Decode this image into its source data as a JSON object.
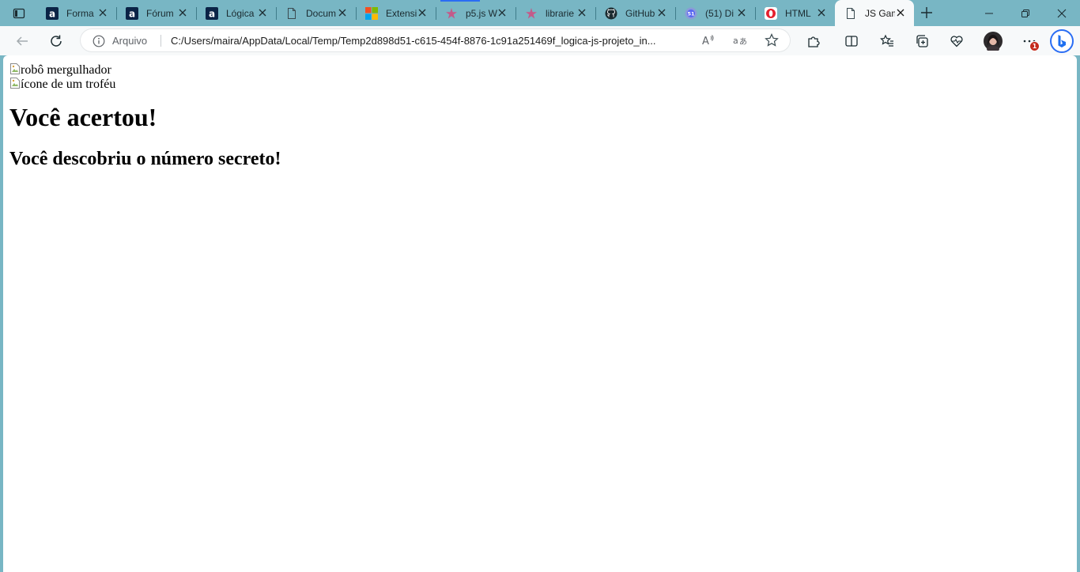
{
  "browser": {
    "tabs": [
      {
        "title": "Forma",
        "icon": "alura-icon"
      },
      {
        "title": "Fórum",
        "icon": "alura-icon"
      },
      {
        "title": "Lógica",
        "icon": "alura-icon"
      },
      {
        "title": "Docum",
        "icon": "document-icon"
      },
      {
        "title": "Extensi",
        "icon": "microsoft-icon"
      },
      {
        "title": "p5.js W",
        "icon": "p5-star-icon"
      },
      {
        "title": "librarie",
        "icon": "p5-star-icon"
      },
      {
        "title": "GitHub",
        "icon": "github-icon"
      },
      {
        "title": "(51) Di",
        "icon": "discord-icon"
      },
      {
        "title": "HTML",
        "icon": "opera-icon"
      },
      {
        "title": "JS Gam",
        "icon": "document-icon",
        "active": true
      }
    ],
    "address": {
      "scheme_label": "Arquivo",
      "url": "C:/Users/maira/AppData/Local/Temp/Temp2d898d51-c615-454f-8876-1c91a251469f_logica-js-projeto_in..."
    },
    "notification_count": "1",
    "colors": {
      "tabstrip": "#78b6c4",
      "toolbar": "#f7f9fa",
      "accent": "#2a6df4",
      "badge": "#c42b1c"
    }
  },
  "page": {
    "images": [
      {
        "alt": "robô mergulhador"
      },
      {
        "alt": "ícone de um troféu"
      }
    ],
    "title": "Você acertou!",
    "subtitle": "Você descobriu o número secreto!"
  }
}
